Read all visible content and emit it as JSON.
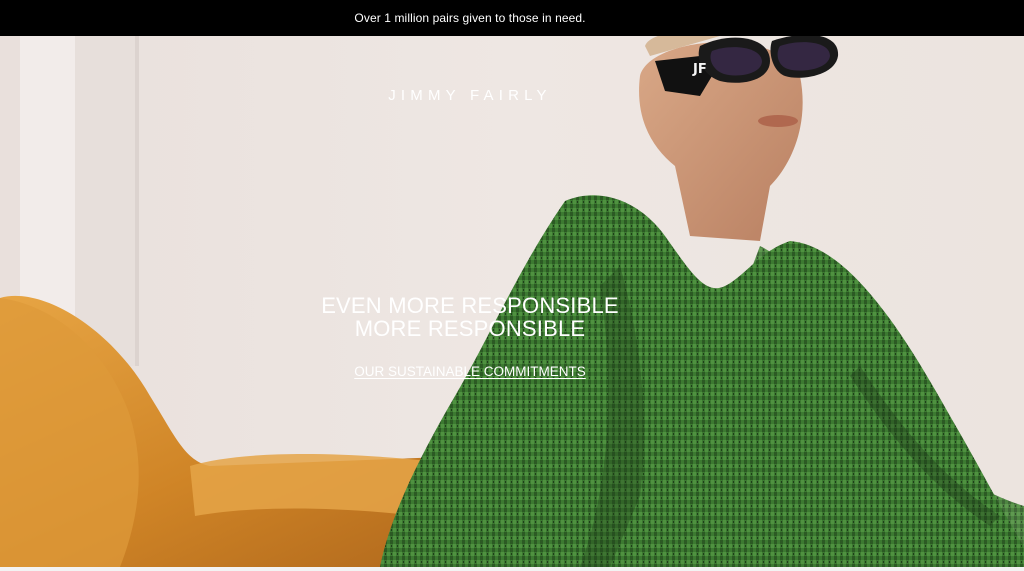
{
  "announcement": {
    "text": "Over 1 million pairs given to those in need."
  },
  "header": {
    "logo_text": "JIMMY FAIRLY"
  },
  "hero": {
    "headline_line1": "EVEN MORE RESPONSIBLE",
    "headline_line2": "MORE RESPONSIBLE",
    "cta_label": "OUR SUSTAINABLE COMMITMENTS",
    "sunglasses_monogram": "JF"
  },
  "colors": {
    "announcement_bg": "#000000",
    "text_on_dark": "#ffffff",
    "sweater_green": "#3f7a33",
    "sofa_orange": "#d48a2b",
    "wall": "#eee6e1"
  }
}
